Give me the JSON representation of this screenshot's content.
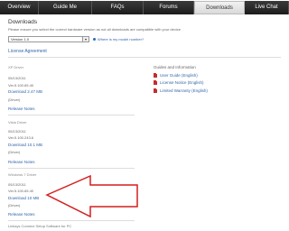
{
  "nav": {
    "tabs": [
      {
        "label": "Overview"
      },
      {
        "label": "Guide Me"
      },
      {
        "label": "FAQs"
      },
      {
        "label": "Forums"
      },
      {
        "label": "Downloads"
      },
      {
        "label": "Live Chat"
      }
    ],
    "active_index": 4
  },
  "main": {
    "title": "Downloads",
    "info": "Please ensure you select the correct hardware version as not all downloads are compatible with your device",
    "hardware_select": {
      "value": "Version 1.0"
    },
    "help_link": "Where is my model number?",
    "license_link": "License Agreement"
  },
  "drivers": [
    {
      "name": "XP Driver",
      "date": "05/13/2011",
      "version": "Ver.5.100.65.40",
      "download": "Download 2.47 MB",
      "type": "(Driver)",
      "notes": "Release Notes"
    },
    {
      "name": "Vista Driver",
      "date": "05/13/2011",
      "version": "Ver.5.100.243.6",
      "download": "Download 10.1 MB",
      "type": "(Driver)",
      "notes": "Release Notes"
    },
    {
      "name": "Windows 7 Driver",
      "date": "05/13/2011",
      "version": "Ver.5.100.65.40",
      "download": "Download 10 MB",
      "type": "(Driver)",
      "notes": "Release Notes"
    }
  ],
  "footer_item": "Linksys Connect Setup Software for PC",
  "guides": {
    "title": "Guides and Information",
    "items": [
      {
        "label": "User Guide (English)"
      },
      {
        "label": "License Notice (English)"
      },
      {
        "label": "Limited Warranty (English)"
      }
    ]
  },
  "colors": {
    "link": "#3366aa",
    "arrow": "#d41f1f",
    "pdf": "#c62d2d"
  }
}
